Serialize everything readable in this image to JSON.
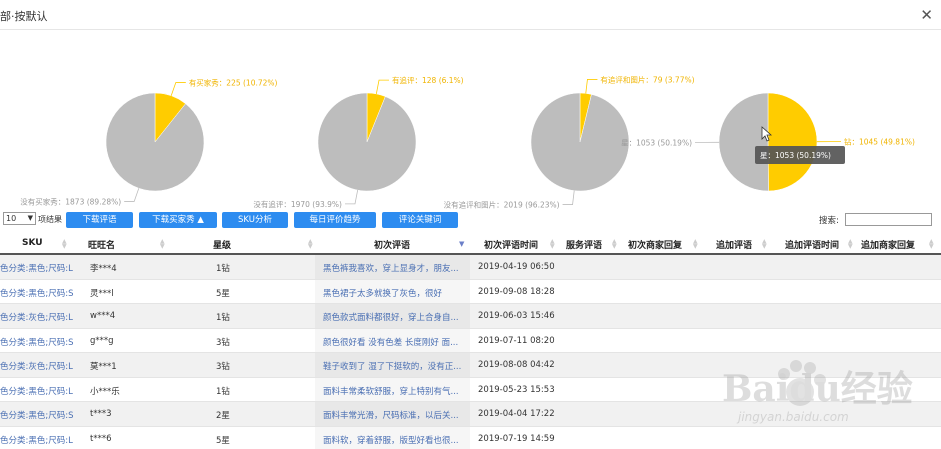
{
  "window": {
    "title": "部·按默认"
  },
  "chart_data": [
    {
      "type": "pie",
      "slices": [
        {
          "label": "有买家秀",
          "value": 225,
          "text": "有买家秀：225 (10.72%)",
          "color": "#FFCC00"
        },
        {
          "label": "没有买家秀",
          "value": 1873,
          "text": "没有买家秀：1873 (89.28%)",
          "color": "#BDBDBD"
        }
      ]
    },
    {
      "type": "pie",
      "slices": [
        {
          "label": "有追评",
          "value": 128,
          "text": "有追评：128 (6.1%)",
          "color": "#FFCC00"
        },
        {
          "label": "没有追评",
          "value": 1970,
          "text": "没有追评：1970 (93.9%)",
          "color": "#BDBDBD"
        }
      ]
    },
    {
      "type": "pie",
      "slices": [
        {
          "label": "有追评和图片",
          "value": 79,
          "text": "有追评和图片：79 (3.77%)",
          "color": "#FFCC00"
        },
        {
          "label": "没有追评和图片",
          "value": 2019,
          "text": "没有追评和图片：2019 (96.23%)",
          "color": "#BDBDBD"
        }
      ]
    },
    {
      "type": "pie",
      "tooltip": "星：1053 (50.19%)",
      "slices": [
        {
          "label": "钻",
          "value": 1045,
          "text": "钻：1045 (49.81%)",
          "color": "#FFCC00"
        },
        {
          "label": "星",
          "value": 1053,
          "text": "星：1053 (50.19%)",
          "color": "#BDBDBD"
        }
      ]
    }
  ],
  "toolbar": {
    "page_size": "10",
    "page_size_label": "项结果",
    "buttons": [
      "下载评语",
      "下载买家秀",
      "SKU分析",
      "每日评价趋势",
      "评论关键词"
    ],
    "search_label": "搜索:"
  },
  "table": {
    "columns": [
      "SKU",
      "旺旺名",
      "星级",
      "初次评语",
      "初次评语时间",
      "服务评语",
      "初次商家回复",
      "追加评语",
      "追加评语时间",
      "追加商家回复"
    ],
    "rows": [
      {
        "sku": "色分类:黑色;尺码:L",
        "name": "李***4",
        "star": "1钻",
        "review": "黑色裤我喜欢，穿上显身才，朋友...",
        "time": "2019-04-19 06:50"
      },
      {
        "sku": "色分类:黑色;尺码:S",
        "name": "灵***l",
        "star": "5星",
        "review": "黑色裙子太多就换了灰色，很好",
        "time": "2019-09-08 18:28"
      },
      {
        "sku": "色分类:灰色;尺码:L",
        "name": "w***4",
        "star": "1钻",
        "review": "颜色款式面料都很好，穿上合身自...",
        "time": "2019-06-03 15:46"
      },
      {
        "sku": "色分类:黑色;尺码:S",
        "name": "g***g",
        "star": "3钻",
        "review": "颜色很好看 没有色差 长度刚好 面...",
        "time": "2019-07-11 08:20"
      },
      {
        "sku": "色分类:灰色;尺码:L",
        "name": "莫***1",
        "star": "3钻",
        "review": "鞋子收到了 湿了下挺软的，没有正...",
        "time": "2019-08-08 04:42"
      },
      {
        "sku": "色分类:黑色;尺码:L",
        "name": "小***乐",
        "star": "1钻",
        "review": "面料丰常柔软舒服，穿上特别有气...",
        "time": "2019-05-23 15:53"
      },
      {
        "sku": "色分类:黑色;尺码:S",
        "name": "t***3",
        "star": "2星",
        "review": "面料丰常光滑，尺码标准，以后关...",
        "time": "2019-04-04 17:22"
      },
      {
        "sku": "色分类:黑色;尺码:L",
        "name": "t***6",
        "star": "5星",
        "review": "面料软，穿着舒服，版型好看也很...",
        "time": "2019-07-19 14:59"
      }
    ]
  },
  "watermark": {
    "brand": "Baidu经验",
    "url": "jingyan.baidu.com"
  }
}
